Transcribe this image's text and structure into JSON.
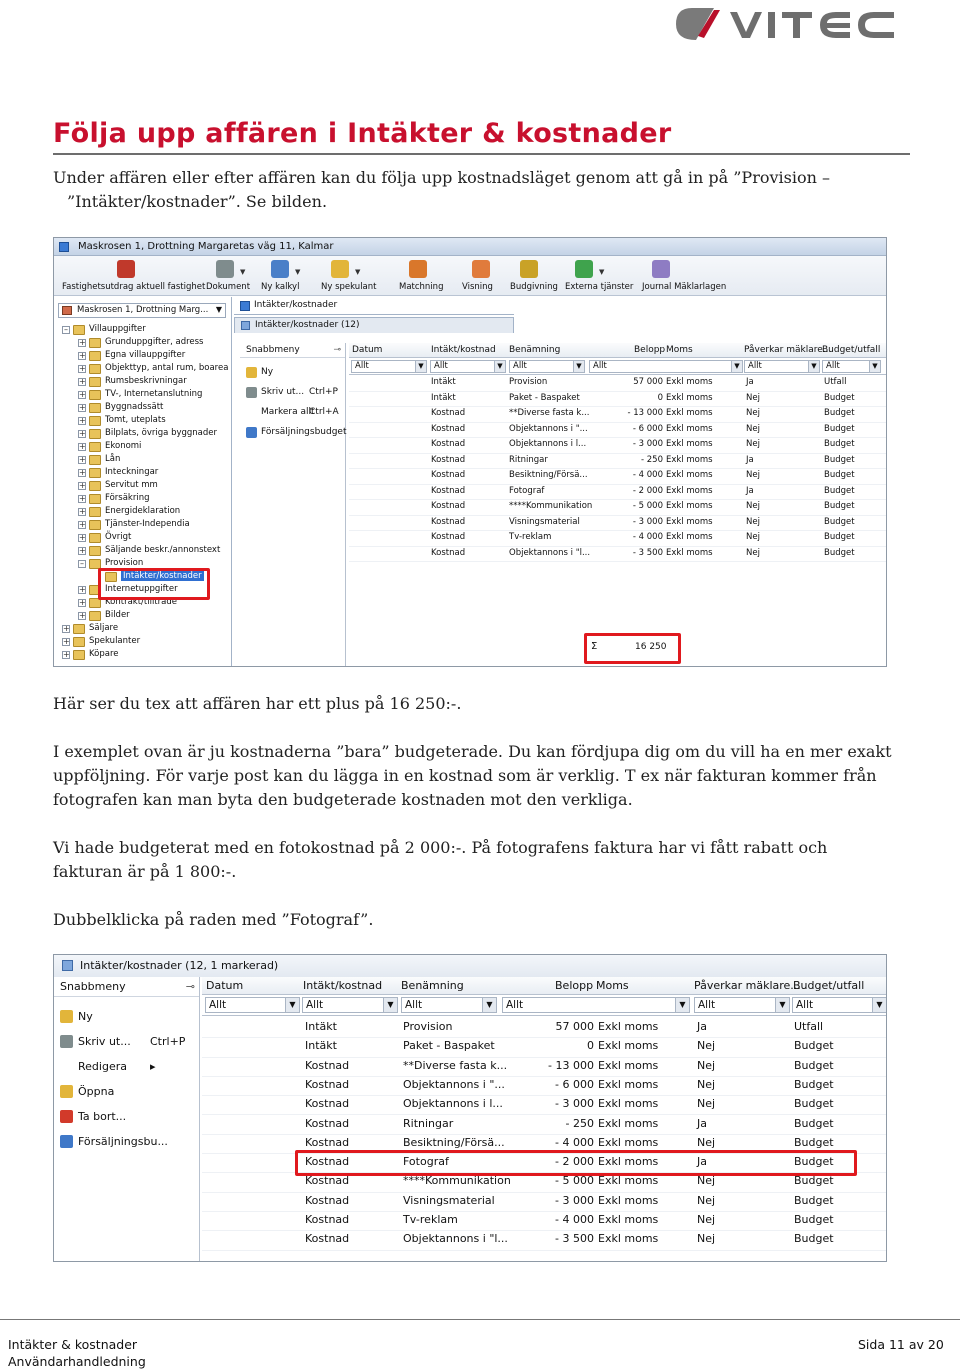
{
  "brand": {
    "logo_text": "vitec",
    "logo_mark_color": "#7a7a7a",
    "logo_accent_color": "#b8102a"
  },
  "document": {
    "title": "Följa upp affären i Intäkter & kostnader",
    "title_color": "#c8102e",
    "intro_line1": "Under affären eller efter affären kan du följa upp kostnadsläget genom att gå in på ”Provision –",
    "intro_line2": "”Intäkter/kostnader”. Se bilden.",
    "plus_note": "Här ser du tex att affären har ett plus på 16 250:-.",
    "example_line1": "I exemplet ovan är ju kostnaderna ”bara” budgeterade. Du kan fördjupa dig om du vill ha en mer exakt",
    "example_line2": "uppföljning. För varje post kan du lägga in en kostnad som är verklig. T ex när fakturan kommer från",
    "example_line3": "fotografen kan man byta den budgeterade kostnaden mot den verkliga.",
    "budget_line1": "Vi hade budgeterat med en fotokostnad på 2 000:-. På fotografens faktura har vi fått rabatt och",
    "budget_line2": "fakturan är på 1 800:-.",
    "dblclick": "Dubbelklicka på raden med ”Fotograf”."
  },
  "screenshot1": {
    "window_title": "Maskrosen 1, Drottning Margaretas väg 11, Kalmar",
    "toolbar": [
      {
        "label": "Fastighetsutdrag aktuell fastighet",
        "icon": "property-extract-icon",
        "color": "#c0392b"
      },
      {
        "label": "Dokument",
        "icon": "document-icon",
        "color": "#7f8c8d",
        "dropdown": true
      },
      {
        "label": "Ny kalkyl",
        "icon": "calculator-icon",
        "color": "#4a7fc8",
        "dropdown": true
      },
      {
        "label": "Ny spekulant",
        "icon": "new-prospect-icon",
        "color": "#e2b53a",
        "dropdown": true
      },
      {
        "label": "Matchning",
        "icon": "handshake-icon",
        "color": "#d9772b"
      },
      {
        "label": "Visning",
        "icon": "viewing-icon",
        "color": "#e07b3c"
      },
      {
        "label": "Budgivning",
        "icon": "money-bag-icon",
        "color": "#c9a227"
      },
      {
        "label": "Externa tjänster",
        "icon": "external-services-icon",
        "color": "#3fa34d",
        "dropdown": true
      },
      {
        "label": "Journal Mäklarlagen",
        "icon": "journal-gears-icon",
        "color": "#8e7cc3"
      }
    ],
    "property_combo": "Maskrosen 1, Drottning Marg...",
    "tree": [
      {
        "label": "Villauppgifter",
        "box": "–",
        "depth": 0
      },
      {
        "label": "Grunduppgifter, adress",
        "box": "+",
        "depth": 1
      },
      {
        "label": "Egna villauppgifter",
        "box": "+",
        "depth": 1
      },
      {
        "label": "Objekttyp, antal rum, boarea",
        "box": "+",
        "depth": 1
      },
      {
        "label": "Rumsbeskrivningar",
        "box": "+",
        "depth": 1
      },
      {
        "label": "TV-, Internetanslutning",
        "box": "+",
        "depth": 1
      },
      {
        "label": "Byggnadssätt",
        "box": "+",
        "depth": 1
      },
      {
        "label": "Tomt, uteplats",
        "box": "+",
        "depth": 1
      },
      {
        "label": "Bilplats, övriga byggnader",
        "box": "+",
        "depth": 1
      },
      {
        "label": "Ekonomi",
        "box": "+",
        "depth": 1
      },
      {
        "label": "Lån",
        "box": "+",
        "depth": 1
      },
      {
        "label": "Inteckningar",
        "box": "+",
        "depth": 1
      },
      {
        "label": "Servitut mm",
        "box": "+",
        "depth": 1
      },
      {
        "label": "Försäkring",
        "box": "+",
        "depth": 1
      },
      {
        "label": "Energideklaration",
        "box": "+",
        "depth": 1
      },
      {
        "label": "Tjänster-Independia",
        "box": "+",
        "depth": 1
      },
      {
        "label": "Övrigt",
        "box": "+",
        "depth": 1
      },
      {
        "label": "Säljande beskr./annonstext",
        "box": "+",
        "depth": 1
      },
      {
        "label": "Provision",
        "box": "–",
        "depth": 1
      },
      {
        "label": "Intäkter/kostnader",
        "box": "",
        "depth": 2,
        "selected": true
      },
      {
        "label": "Internetuppgifter",
        "box": "+",
        "depth": 1
      },
      {
        "label": "Kontrakt/tillträde",
        "box": "+",
        "depth": 1
      },
      {
        "label": "Bilder",
        "box": "+",
        "depth": 1
      },
      {
        "label": "Säljare",
        "box": "+",
        "depth": 0
      },
      {
        "label": "Spekulanter",
        "box": "+",
        "depth": 0
      },
      {
        "label": "Köpare",
        "box": "+",
        "depth": 0
      }
    ],
    "panel_title": "Intäkter/kostnader",
    "tab_title": "Intäkter/kostnader (12)",
    "quick_title": "Snabbmeny",
    "quick_items": [
      {
        "label": "Ny",
        "shortcut": "",
        "icon": "new-icon",
        "color": "#e2b53a"
      },
      {
        "label": "Skriv ut...",
        "shortcut": "Ctrl+P",
        "icon": "print-icon",
        "color": "#7f8c8d"
      },
      {
        "label": "Markera allt",
        "shortcut": "Ctrl+A",
        "icon": "",
        "color": ""
      },
      {
        "label": "Försäljningsbudget",
        "shortcut": "",
        "icon": "sales-budget-icon",
        "color": "#3f78c8"
      }
    ],
    "sum_symbol": "Σ",
    "sum_value": "16 250"
  },
  "screenshot2": {
    "tab_title": "Intäkter/kostnader (12, 1 markerad)",
    "quick_title": "Snabbmeny",
    "quick_items": [
      {
        "label": "Ny",
        "shortcut": "",
        "icon": "new-icon",
        "color": "#e2b53a"
      },
      {
        "label": "Skriv ut...",
        "shortcut": "Ctrl+P",
        "icon": "print-icon",
        "color": "#7f8c8d"
      },
      {
        "label": "Redigera",
        "shortcut": "▸",
        "icon": "",
        "color": ""
      },
      {
        "label": "Öppna",
        "shortcut": "",
        "icon": "open-folder-icon",
        "color": "#e2b53a"
      },
      {
        "label": "Ta bort...",
        "shortcut": "",
        "icon": "delete-icon",
        "color": "#d23a2a"
      },
      {
        "label": "Försäljningsbu...",
        "shortcut": "",
        "icon": "sales-budget-icon",
        "color": "#3f78c8"
      }
    ]
  },
  "grid": {
    "columns": [
      "Datum",
      "Intäkt/kostnad",
      "Benämning",
      "Belopp",
      "Moms",
      "Påverkar mäklare...",
      "Budget/utfall"
    ],
    "filters": [
      "Allt",
      "Allt",
      "Allt",
      "Allt",
      "",
      "Allt",
      "Allt"
    ],
    "rows": [
      {
        "datum": "",
        "typ": "Intäkt",
        "benamning": "Provision",
        "belopp": "57 000",
        "moms": "Exkl moms",
        "paverkar": "Ja",
        "budget": "Utfall"
      },
      {
        "datum": "",
        "typ": "Intäkt",
        "benamning": "Paket - Baspaket",
        "belopp": "0",
        "moms": "Exkl moms",
        "paverkar": "Nej",
        "budget": "Budget"
      },
      {
        "datum": "",
        "typ": "Kostnad",
        "benamning": "**Diverse fasta k...",
        "belopp": "- 13 000",
        "moms": "Exkl moms",
        "paverkar": "Nej",
        "budget": "Budget"
      },
      {
        "datum": "",
        "typ": "Kostnad",
        "benamning": "Objektannons i \"...",
        "belopp": "- 6 000",
        "moms": "Exkl moms",
        "paverkar": "Nej",
        "budget": "Budget"
      },
      {
        "datum": "",
        "typ": "Kostnad",
        "benamning": "Objektannons i l...",
        "belopp": "- 3 000",
        "moms": "Exkl moms",
        "paverkar": "Nej",
        "budget": "Budget"
      },
      {
        "datum": "",
        "typ": "Kostnad",
        "benamning": "Ritningar",
        "belopp": "- 250",
        "moms": "Exkl moms",
        "paverkar": "Ja",
        "budget": "Budget"
      },
      {
        "datum": "",
        "typ": "Kostnad",
        "benamning": "Besiktning/Försä...",
        "belopp": "- 4 000",
        "moms": "Exkl moms",
        "paverkar": "Nej",
        "budget": "Budget"
      },
      {
        "datum": "",
        "typ": "Kostnad",
        "benamning": "Fotograf",
        "belopp": "- 2 000",
        "moms": "Exkl moms",
        "paverkar": "Ja",
        "budget": "Budget"
      },
      {
        "datum": "",
        "typ": "Kostnad",
        "benamning": "****Kommunikation",
        "belopp": "- 5 000",
        "moms": "Exkl moms",
        "paverkar": "Nej",
        "budget": "Budget"
      },
      {
        "datum": "",
        "typ": "Kostnad",
        "benamning": "Visningsmaterial",
        "belopp": "- 3 000",
        "moms": "Exkl moms",
        "paverkar": "Nej",
        "budget": "Budget"
      },
      {
        "datum": "",
        "typ": "Kostnad",
        "benamning": "Tv-reklam",
        "belopp": "- 4 000",
        "moms": "Exkl moms",
        "paverkar": "Nej",
        "budget": "Budget"
      },
      {
        "datum": "",
        "typ": "Kostnad",
        "benamning": "Objektannons i \"l...",
        "belopp": "- 3 500",
        "moms": "Exkl moms",
        "paverkar": "Nej",
        "budget": "Budget"
      }
    ]
  },
  "footer": {
    "left_line1": "Intäkter & kostnader",
    "left_line2": "Användarhandledning",
    "right": "Sida 11 av 20"
  }
}
